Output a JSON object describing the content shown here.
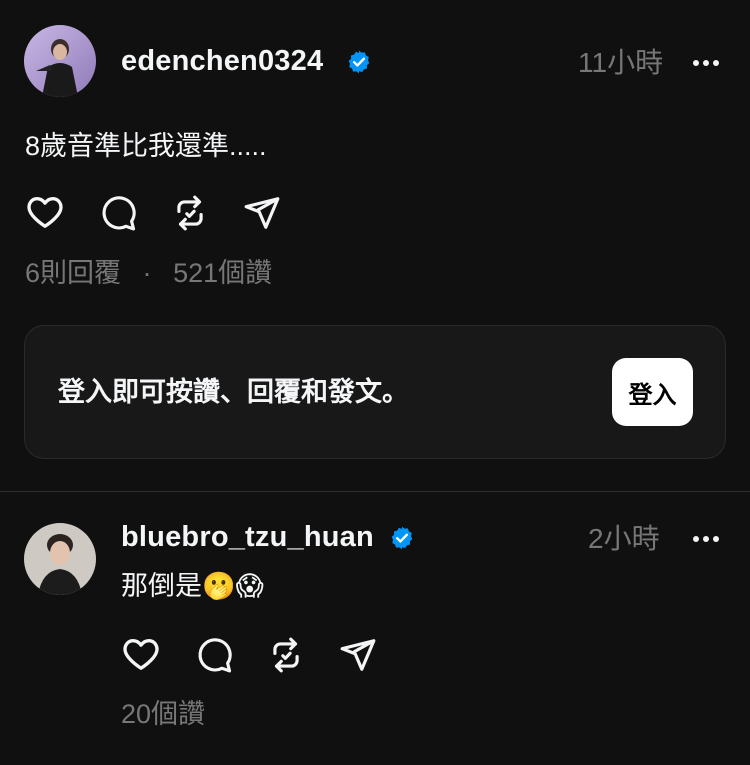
{
  "post": {
    "username": "edenchen0324",
    "time": "11小時",
    "text": "8歲音準比我還準.....",
    "replies": "6則回覆",
    "separator": "·",
    "likes": "521個讚"
  },
  "login_prompt": {
    "text": "登入即可按讚、回覆和發文。",
    "button_label": "登入"
  },
  "reply": {
    "username": "bluebro_tzu_huan",
    "time": "2小時",
    "text": "那倒是",
    "emojis": "🫢😱",
    "likes": "20個讚"
  },
  "colors": {
    "background": "#101010",
    "text_primary": "#f3f5f7",
    "text_secondary": "#777777",
    "verified": "#0095f6"
  },
  "icons": [
    "heart-icon",
    "comment-icon",
    "repost-icon",
    "share-icon",
    "verified-badge-icon",
    "more-options-icon"
  ]
}
